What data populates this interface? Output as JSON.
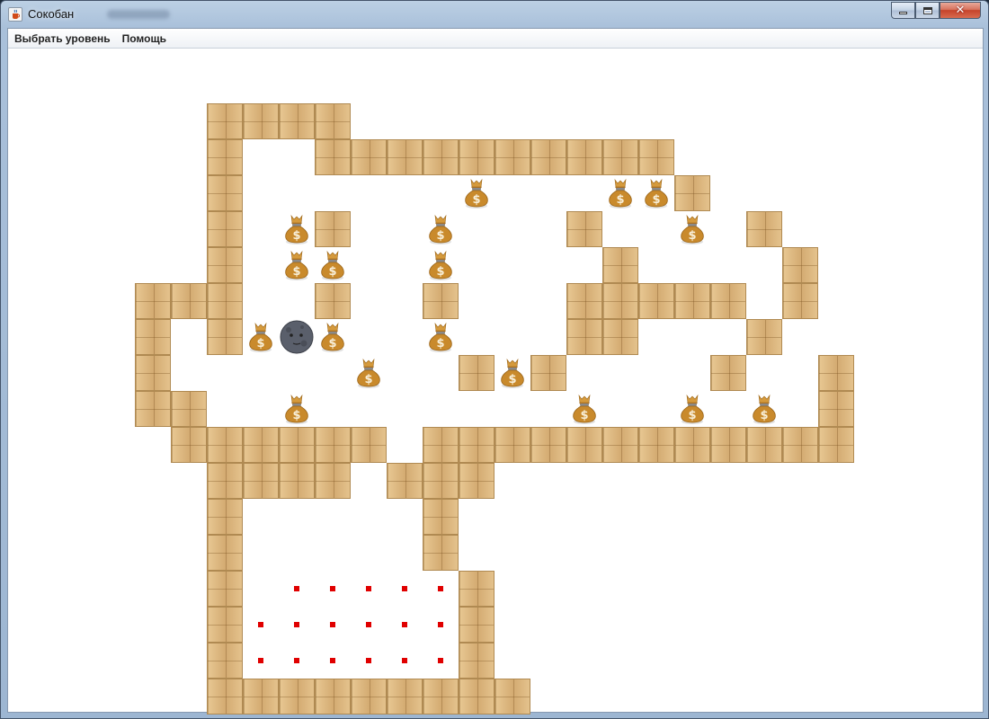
{
  "window": {
    "title": "Сокобан",
    "icon": "java-cup-icon",
    "buttons": [
      "minimize-icon",
      "maximize-icon",
      "close-icon"
    ]
  },
  "menu": {
    "items": [
      {
        "label": "Выбрать уровень"
      },
      {
        "label": "Помощь"
      }
    ]
  },
  "game": {
    "cell_kinds": {
      "wall": "wooden-crate-wall-icon",
      "box": "money-bag-icon",
      "player": "new-moon-face-icon",
      "target": "red-dot-target"
    },
    "colors": {
      "wall": "#dcb57c",
      "target": "#e00000",
      "box": "#c98a2c",
      "player": "#5a5f6b"
    },
    "level": [
      "    ####             ",
      "    #  ##########    ",
      "    #      $   $$#    ",
      "    # $#  $   #  $ #  ",
      "    # $$  $    #    # ",
      "  ###  #  #   ##### # ",
      "  # #$@$  $   ##   # ",
      "  #     $  #$#    #  # ",
      "  ##  $       $  $ $ # ",
      "   ###### ############ ",
      "    #### ###           ",
      "    #     #           ",
      "    #     #           ",
      "    # .....#           ",
      "    #......#           ",
      "    #......#           ",
      "    #########          "
    ]
  }
}
